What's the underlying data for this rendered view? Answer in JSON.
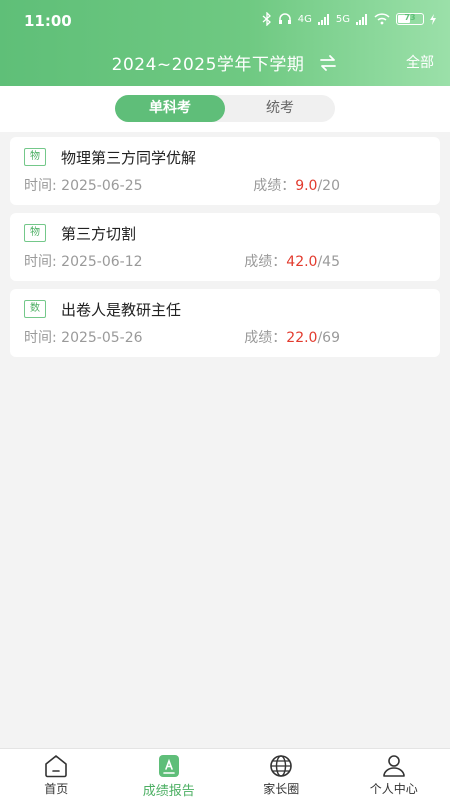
{
  "status_bar": {
    "time": "11:00",
    "network_1": "4G",
    "network_2": "5G",
    "battery": "73"
  },
  "header": {
    "term": "2024~2025学年下学期",
    "swap_icon": "swap-icon",
    "all_label": "全部"
  },
  "segments": {
    "tab1": "单科考",
    "tab2": "统考",
    "active": "单科考"
  },
  "exams": [
    {
      "subject": "物",
      "title": "物理第三方同学优解",
      "time_label": "时间:",
      "date": "2025-06-25",
      "score_label": "成绩：",
      "score": "9.0",
      "total": "/20"
    },
    {
      "subject": "物",
      "title": "第三方切割",
      "time_label": "时间:",
      "date": "2025-06-12",
      "score_label": "成绩：",
      "score": "42.0",
      "total": "/45"
    },
    {
      "subject": "数",
      "title": "出卷人是教研主任",
      "time_label": "时间:",
      "date": "2025-05-26",
      "score_label": "成绩：",
      "score": "22.0",
      "total": "/69"
    }
  ],
  "tabbar": {
    "home": "首页",
    "report": "成绩报告",
    "parents": "家长圈",
    "profile": "个人中心",
    "active": "成绩报告"
  },
  "colors": {
    "accent": "#5fbe79",
    "score_red": "#e23b2e"
  }
}
